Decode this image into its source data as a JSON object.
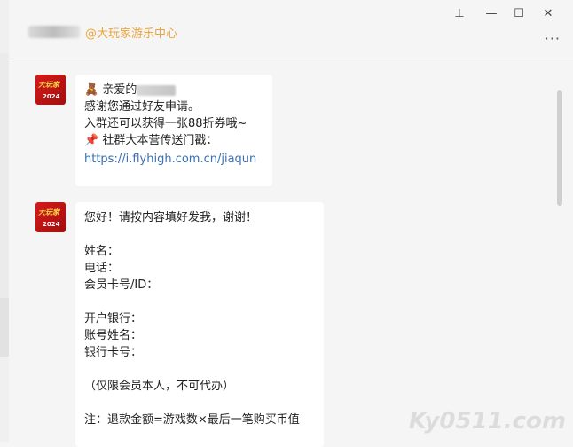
{
  "window": {
    "contact_suffix": "@大玩家游乐中心",
    "pin_icon": "pin-icon",
    "minimize_icon": "minimize-icon",
    "maximize_icon": "maximize-icon",
    "close_icon": "close-icon",
    "more_icon": "more-icon"
  },
  "avatar": {
    "logo_text": "大玩家",
    "year": "2024"
  },
  "message1": {
    "emoji1": "🧸",
    "greeting": "亲爱的",
    "line2": "感谢您通过好友申请。",
    "line3": "入群还可以获得一张88折券哦~",
    "emoji2": "📌",
    "line4": "社群大本营传送门戳：",
    "link": "https://i.flyhigh.com.cn/jiaqun"
  },
  "message2": {
    "lines": [
      "您好！请按内容填好发我，谢谢！",
      "",
      "姓名：",
      "电话：",
      "会员卡号/ID：",
      "",
      "开户银行：",
      "账号姓名：",
      "银行卡号：",
      "",
      "（仅限会员本人，不可代办）",
      "",
      "注：退款金额=游戏数×最后一笔购买币值"
    ]
  },
  "watermark": "Ky0511.com"
}
